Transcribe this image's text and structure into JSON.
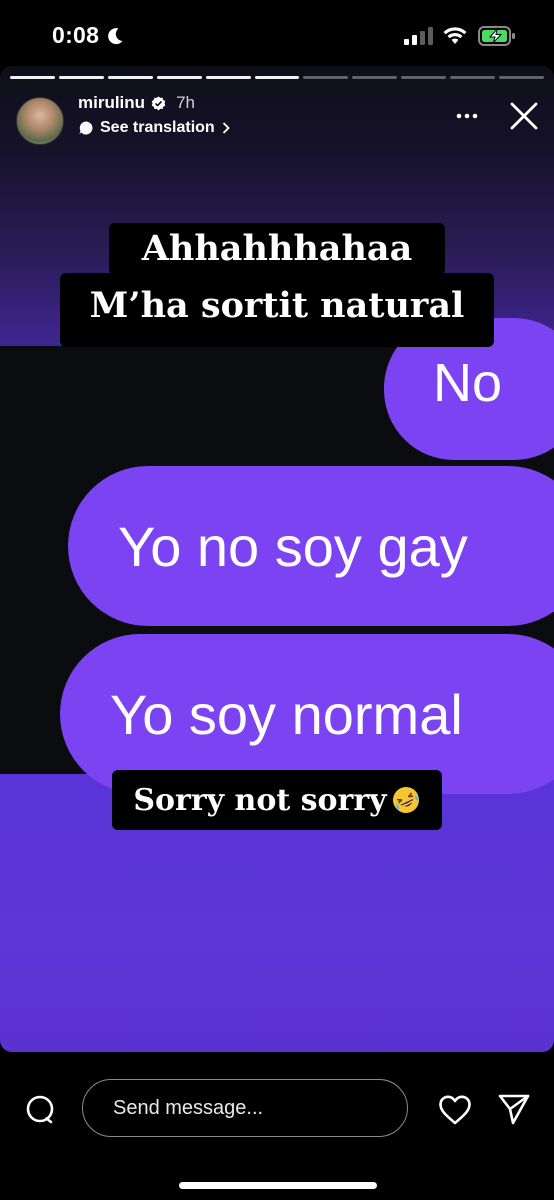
{
  "status_bar": {
    "time": "0:08",
    "icons": [
      "moon-icon",
      "cellular-signal-icon",
      "wifi-icon",
      "battery-charging-icon"
    ]
  },
  "story": {
    "progress_segments_total": 11,
    "progress_segments_viewed": 6,
    "user": {
      "username": "mirulinu",
      "verified": true,
      "age": "7h"
    },
    "translation_label": "See translation",
    "header_icons": [
      "more-icon",
      "close-icon"
    ]
  },
  "content": {
    "caption_line1": "Ahhahhhahaa",
    "caption_line2": "M’ha sortit natural",
    "bubbles": [
      "No",
      "Yo no soy gay",
      "Yo soy normal"
    ],
    "caption_bottom": "Sorry not sorry",
    "caption_bottom_emoji": "rolling-on-the-floor-laughing"
  },
  "bottom_bar": {
    "send_placeholder": "Send message..."
  },
  "colors": {
    "bubble": "#7b43f2",
    "bottom_gradient": "#5a34d8",
    "background": "#000000"
  }
}
